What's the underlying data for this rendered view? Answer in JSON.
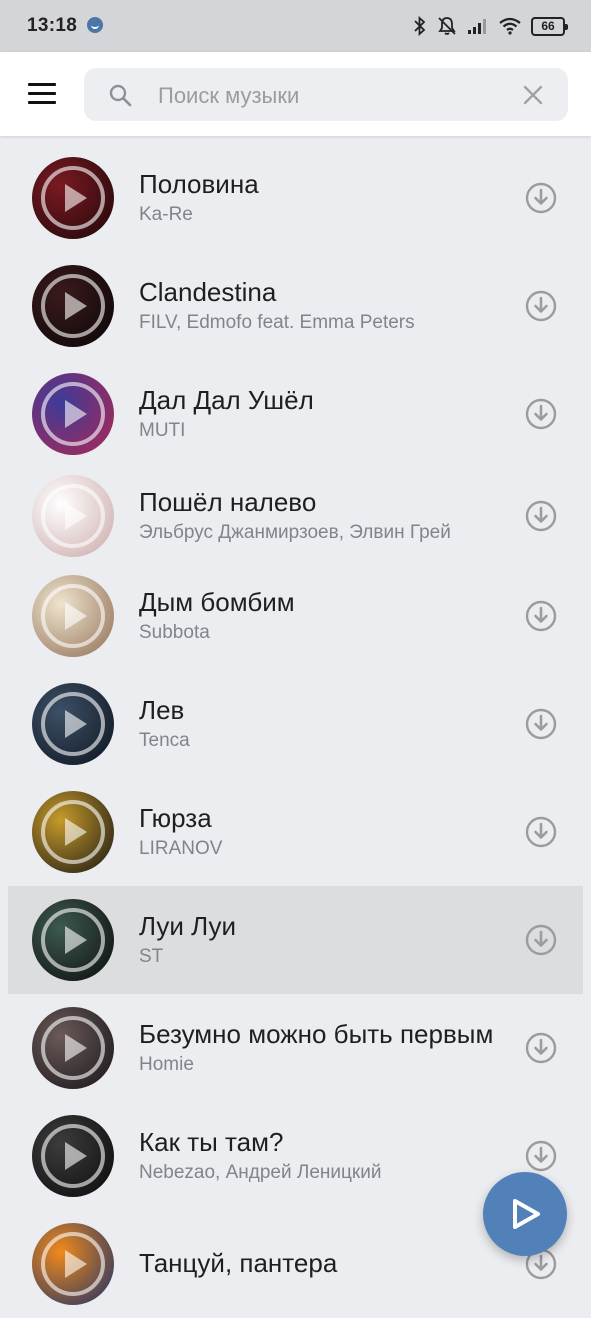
{
  "status_bar": {
    "time": "13:18",
    "battery": "66",
    "icons": [
      "vk-notification-icon",
      "bluetooth-icon",
      "mute-icon",
      "signal-icon",
      "wifi-icon",
      "battery-icon"
    ]
  },
  "header": {
    "search_placeholder": "Поиск музыки",
    "search_value": "",
    "icons": [
      "menu-icon",
      "search-icon",
      "clear-icon"
    ]
  },
  "tracks": [
    {
      "title": "Половина",
      "artist": "Ka-Re",
      "cover_colors": [
        "#7a1a22",
        "#1c0709"
      ]
    },
    {
      "title": "Clandestina",
      "artist": "FILV, Edmofo feat. Emma Peters",
      "cover_colors": [
        "#3a1a1c",
        "#0a0606"
      ]
    },
    {
      "title": "Дал Дал Ушёл",
      "artist": "MUTI",
      "cover_colors": [
        "#3b3b9a",
        "#b02850"
      ]
    },
    {
      "title": "Пошёл налево",
      "artist": "Эльбрус Джанмирзоев, Элвин Грей",
      "cover_colors": [
        "#ffffff",
        "#c9a7a7"
      ]
    },
    {
      "title": "Дым бомбим",
      "artist": "Subbota",
      "cover_colors": [
        "#efe4cf",
        "#8e6e52"
      ]
    },
    {
      "title": "Лев",
      "artist": "Tenca",
      "cover_colors": [
        "#3d5066",
        "#0c141f"
      ]
    },
    {
      "title": "Гюрза",
      "artist": "LIRANOV",
      "cover_colors": [
        "#c79a2a",
        "#151515"
      ]
    },
    {
      "title": "Луи Луи",
      "artist": "ST",
      "cover_colors": [
        "#3d5a4f",
        "#0b0b0b"
      ]
    },
    {
      "title": "Безумно можно быть первым",
      "artist": "Homie",
      "cover_colors": [
        "#6a5a57",
        "#161418"
      ]
    },
    {
      "title": "Как ты там?",
      "artist": "Nebezao, Андрей Леницкий",
      "cover_colors": [
        "#3c3c3c",
        "#0a0a0a"
      ]
    },
    {
      "title": "Танцуй, пантера",
      "artist": "",
      "cover_colors": [
        "#f08a1a",
        "#1a2f6a"
      ]
    }
  ],
  "active_track_index": 7,
  "colors": {
    "accent": "#5181b8",
    "background": "#ebedf0",
    "active_row": "#dcdddf",
    "icon_gray": "#9a9ca0"
  },
  "fab": {
    "icon": "play-icon"
  }
}
